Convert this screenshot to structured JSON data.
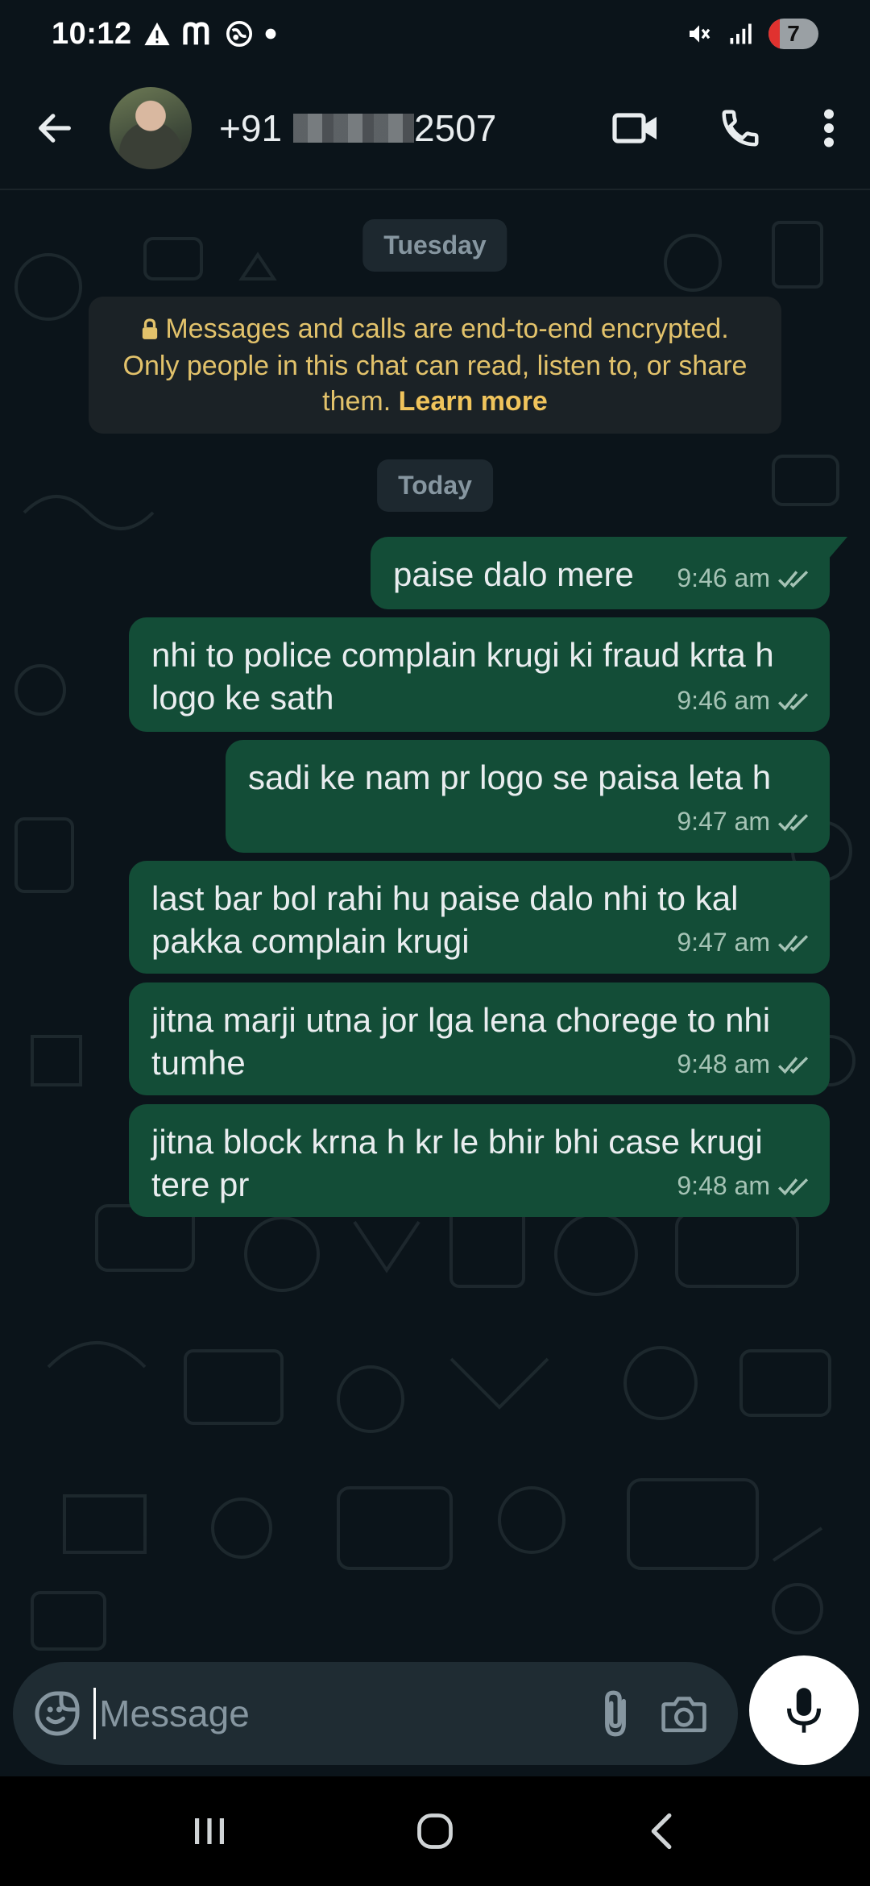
{
  "status_bar": {
    "time": "10:12",
    "battery_level": "7",
    "icons": [
      "warning-icon",
      "m-icon",
      "vpn-icon",
      "dot-icon",
      "mute-icon",
      "signal-icon",
      "battery-icon"
    ]
  },
  "header": {
    "contact_prefix": "+91",
    "contact_suffix": "2507",
    "icons": [
      "back-arrow-icon",
      "avatar",
      "video-call-icon",
      "phone-icon",
      "more-vert-icon"
    ]
  },
  "chat": {
    "days": [
      "Tuesday",
      "Today"
    ],
    "encryption_notice": {
      "text": "Messages and calls are end-to-end encrypted. Only people in this chat can read, listen to, or share them.",
      "link": "Learn more"
    },
    "messages": [
      {
        "text": "paise dalo mere",
        "time": "9:46 am",
        "status": "read"
      },
      {
        "text": "nhi to police complain krugi ki fraud krta h logo ke sath",
        "time": "9:46 am",
        "status": "read"
      },
      {
        "text": "sadi ke nam pr logo se paisa leta h",
        "time": "9:47 am",
        "status": "read"
      },
      {
        "text": "last bar bol rahi hu paise dalo nhi to kal pakka complain krugi",
        "time": "9:47 am",
        "status": "read"
      },
      {
        "text": "jitna marji utna jor lga lena chorege to nhi tumhe",
        "time": "9:48 am",
        "status": "read"
      },
      {
        "text": "jitna block krna h kr le bhir bhi case krugi tere pr",
        "time": "9:48 am",
        "status": "read"
      }
    ]
  },
  "composer": {
    "placeholder": "Message",
    "icons": [
      "sticker-icon",
      "attach-icon",
      "camera-icon",
      "mic-icon"
    ]
  },
  "navbar": {
    "icons": [
      "recents-icon",
      "home-icon",
      "back-icon"
    ]
  },
  "colors": {
    "background": "#0b141a",
    "outgoing_bubble": "#134d37",
    "encryption_text": "#e2c26b",
    "day_pill": "#1d282f"
  }
}
